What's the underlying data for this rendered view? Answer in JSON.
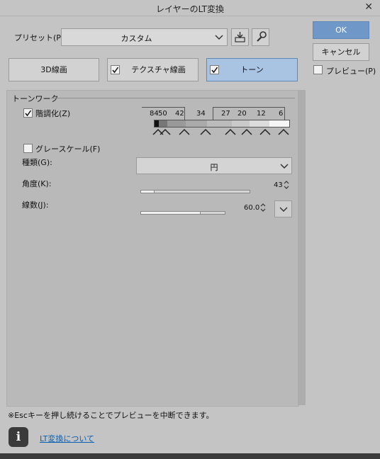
{
  "window": {
    "title": "レイヤーのLT変換",
    "close": "✕"
  },
  "preset": {
    "label": "プリセット(P):",
    "value": "カスタム"
  },
  "side": {
    "ok": "OK",
    "cancel": "キャンセル",
    "preview": "プレビュー(P)",
    "preview_checked": false
  },
  "tabs": [
    {
      "label": "3D線画",
      "checkable": false,
      "checked": false,
      "active": false
    },
    {
      "label": "テクスチャ線画",
      "checkable": true,
      "checked": true,
      "active": false
    },
    {
      "label": "トーン",
      "checkable": true,
      "checked": true,
      "active": true
    }
  ],
  "tone": {
    "section": "トーンワーク",
    "posterize": {
      "label": "階調化(Z)",
      "checked": true
    },
    "levels": [
      "84",
      "50",
      "42",
      "34",
      "27",
      "20",
      "12",
      "6"
    ],
    "grayscale": {
      "label": "グレースケール(F)",
      "checked": false
    },
    "kind": {
      "label": "種類(G):",
      "value": "円"
    },
    "angle": {
      "label": "角度(K):",
      "value": "43",
      "fraction": 0.12
    },
    "lines": {
      "label": "線数(J):",
      "value": "60.0",
      "fraction": 0.7
    }
  },
  "footer": {
    "note": "※Escキーを押し続けることでプレビューを中断できます。",
    "link": "LT変換について",
    "info": "i"
  },
  "colors": {
    "accent": "#6f98c9",
    "accent_tab": "#a9c3e3",
    "link": "#0b5fb3"
  },
  "icons": [
    "chevron-down-icon",
    "import-icon",
    "wrench-icon",
    "check-icon",
    "info-icon",
    "spinner-icon"
  ]
}
